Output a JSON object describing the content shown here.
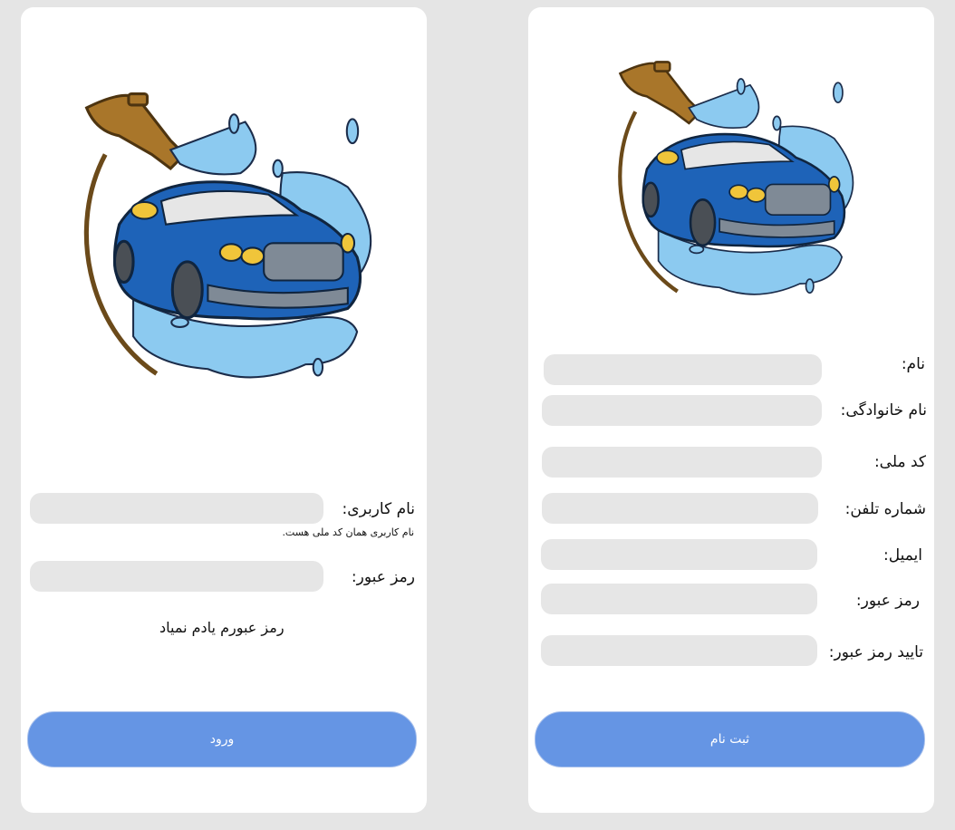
{
  "login": {
    "username_label": "نام کاربری:",
    "username_hint": "نام کاربری همان کد ملی هست.",
    "username_value": "",
    "password_label": "رمز عبور:",
    "password_value": "",
    "forgot_password": "رمز عبورم یادم نمیاد",
    "submit_label": "ورود"
  },
  "signup": {
    "first_name_label": "نام:",
    "last_name_label": "نام خانوادگی:",
    "national_code_label": "کد ملی:",
    "phone_label": "شماره تلفن:",
    "email_label": "ایمیل:",
    "password_label": "رمز عبور:",
    "confirm_password_label": "تایید رمز عبور:",
    "submit_label": "ثبت نام"
  },
  "logo": {
    "icon": "car-wash-icon"
  },
  "colors": {
    "background": "#e5e5e5",
    "card": "#ffffff",
    "input": "#e6e6e6",
    "button": "#6595e4",
    "car_body": "#1e63b8",
    "water": "#8ccaf0",
    "nozzle": "#a9762a"
  }
}
